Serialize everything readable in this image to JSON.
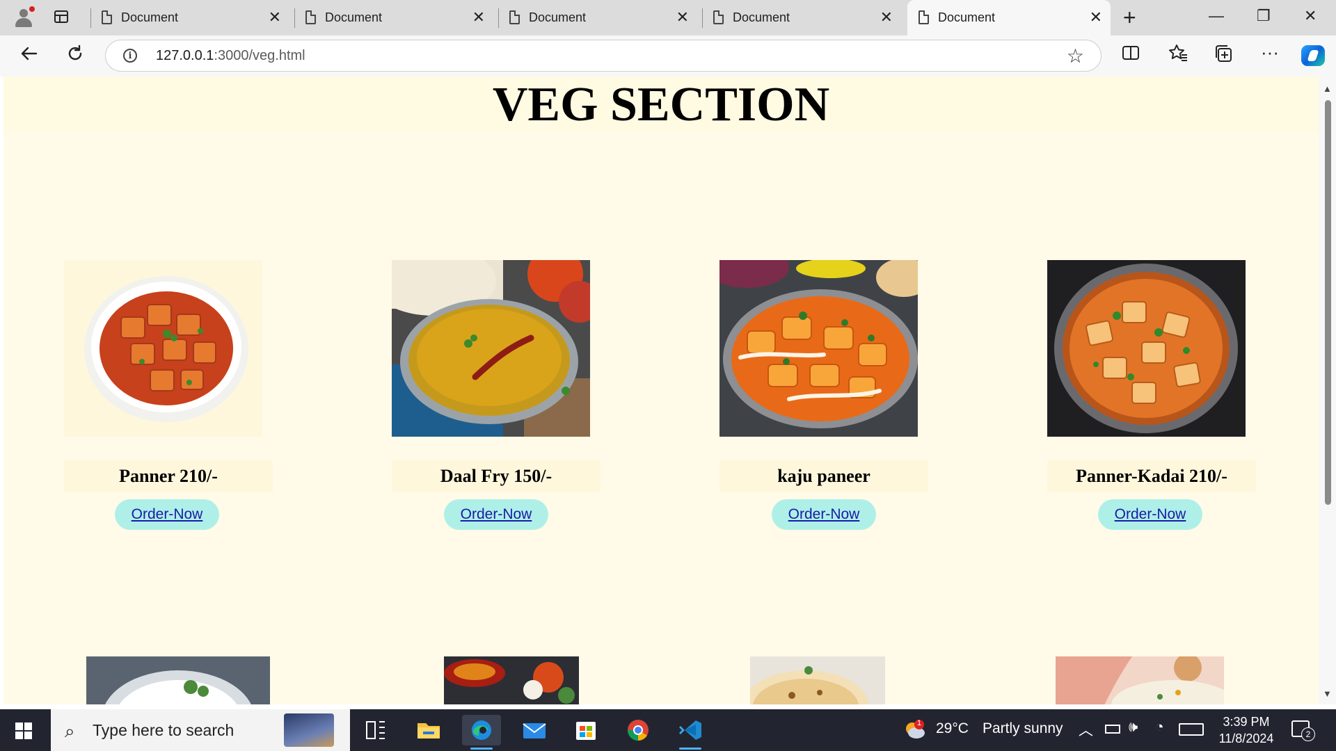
{
  "browser": {
    "tabs": [
      {
        "label": "Document",
        "active": false
      },
      {
        "label": "Document",
        "active": false
      },
      {
        "label": "Document",
        "active": false
      },
      {
        "label": "Document",
        "active": false
      },
      {
        "label": "Document",
        "active": true
      }
    ],
    "tab_close_glyph": "✕",
    "new_tab_glyph": "+",
    "window_controls": {
      "minimize": "—",
      "restore": "❐",
      "close": "✕"
    },
    "address": {
      "host": "127.0.0.1",
      "path": ":3000/veg.html"
    },
    "icons": {
      "back": "back-arrow-icon",
      "refresh": "refresh-icon",
      "info": "site-info-icon",
      "favorite": "star-icon",
      "split": "split-screen-icon",
      "favorites": "favorites-icon",
      "collections": "collections-icon",
      "more": "more-icon",
      "copilot": "copilot-icon"
    }
  },
  "page": {
    "title": "VEG SECTION",
    "background": "#fffbe8",
    "items": [
      {
        "name": "Panner 210/-",
        "button": "Order-Now"
      },
      {
        "name": "Daal Fry 150/-",
        "button": "Order-Now"
      },
      {
        "name": "kaju paneer",
        "button": "Order-Now"
      },
      {
        "name": "Panner-Kadai 210/-",
        "button": "Order-Now"
      }
    ],
    "button_color": "#aef0e8",
    "link_color": "#1a1aa8"
  },
  "taskbar": {
    "search_placeholder": "Type here to search",
    "weather": {
      "temp": "29°C",
      "condition": "Partly sunny",
      "badge": "1"
    },
    "time": "3:39 PM",
    "date": "11/8/2024",
    "notification_count": "2",
    "apps": [
      "task-view-icon",
      "file-explorer-icon",
      "edge-icon",
      "mail-icon",
      "store-icon",
      "chrome-icon",
      "vscode-icon"
    ]
  }
}
